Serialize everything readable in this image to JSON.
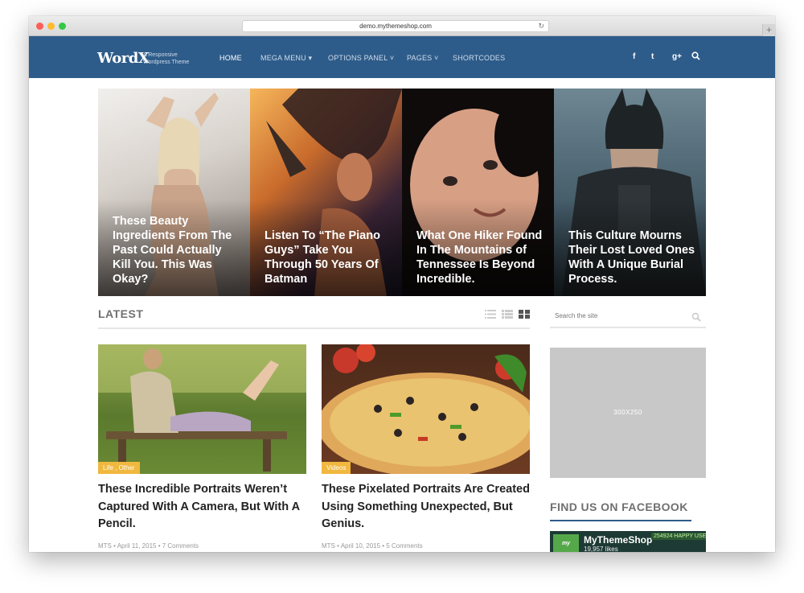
{
  "browser": {
    "url": "demo.mythemeshop.com",
    "newtab_label": "+"
  },
  "header": {
    "logo": "WordX",
    "tagline_line1": "A Responsive",
    "tagline_line2": "Wordpress Theme",
    "nav": [
      {
        "label": "HOME",
        "active": true
      },
      {
        "label": "MEGA MENU ▾"
      },
      {
        "label": "OPTIONS PANEL ˅"
      },
      {
        "label": "PAGES ˅"
      },
      {
        "label": "SHORTCODES"
      }
    ],
    "social": {
      "facebook": "f",
      "twitter": "t",
      "google_plus": "g+"
    },
    "bg_color": "#2e5c8a"
  },
  "featured": [
    {
      "title": "These Beauty Ingredients From The Past Could Actually Kill You. This Was Okay?"
    },
    {
      "title": "Listen To “The Piano Guys” Take You Through 50 Years Of Batman"
    },
    {
      "title": "What One Hiker Found In The Mountains of Tennessee Is Beyond Incredible."
    },
    {
      "title": "This Culture Mourns Their Lost Loved Ones With A Unique Burial Process."
    }
  ],
  "latest": {
    "heading": "LATEST",
    "posts": [
      {
        "category": "Life , Other",
        "title": "These Incredible Portraits Weren’t Captured With A Camera, But With A Pencil.",
        "meta": "MTS • April 11, 2015 • 7 Comments"
      },
      {
        "category": "Videos",
        "title": "These Pixelated Portraits Are Created Using Something Unexpected, But Genius.",
        "meta": "MTS • April 10, 2015 • 5 Comments"
      }
    ],
    "badge_color": "#f0b83e"
  },
  "sidebar": {
    "search_placeholder": "Search the site",
    "ad_label": "300X250",
    "facebook_heading": "FIND US ON FACEBOOK",
    "facebook_widget": {
      "logo_text": "my theme",
      "page_name": "MyThemeShop",
      "likes": "19,957 likes",
      "banner": "254924 HAPPY USE"
    }
  }
}
